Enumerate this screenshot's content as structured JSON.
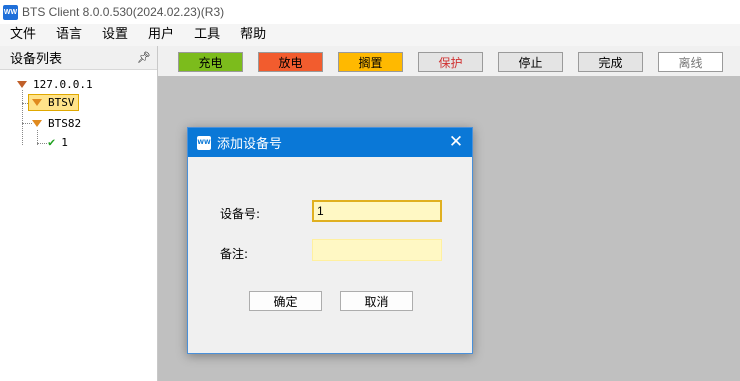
{
  "window": {
    "title": "BTS Client 8.0.0.530(2024.02.23)(R3)",
    "icon": "WW"
  },
  "menu": [
    "文件",
    "语言",
    "设置",
    "用户",
    "工具",
    "帮助"
  ],
  "sidebar": {
    "title": "设备列表",
    "pin_icon": "pin-icon",
    "tree": {
      "root": "127.0.0.1",
      "node1": "BTSV",
      "node2": "BTS82",
      "child": "1"
    }
  },
  "toolbar": {
    "buttons": [
      {
        "label": "充电",
        "bg": "#7cbc1c",
        "color": "#000000"
      },
      {
        "label": "放电",
        "bg": "#f25c2e",
        "color": "#000000"
      },
      {
        "label": "搁置",
        "bg": "#ffb900",
        "color": "#000000"
      },
      {
        "label": "保护",
        "bg": "#e4e4e4",
        "color": "#d03030"
      },
      {
        "label": "停止",
        "bg": "#e4e4e4",
        "color": "#000000"
      },
      {
        "label": "完成",
        "bg": "#e4e4e4",
        "color": "#000000"
      },
      {
        "label": "离线",
        "bg": "#ffffff",
        "color": "#777777"
      }
    ]
  },
  "dialog": {
    "title": "添加设备号",
    "icon": "WW",
    "device_label": "设备号:",
    "device_value": "1",
    "note_label": "备注:",
    "note_value": "",
    "ok_label": "确定",
    "cancel_label": "取消"
  }
}
